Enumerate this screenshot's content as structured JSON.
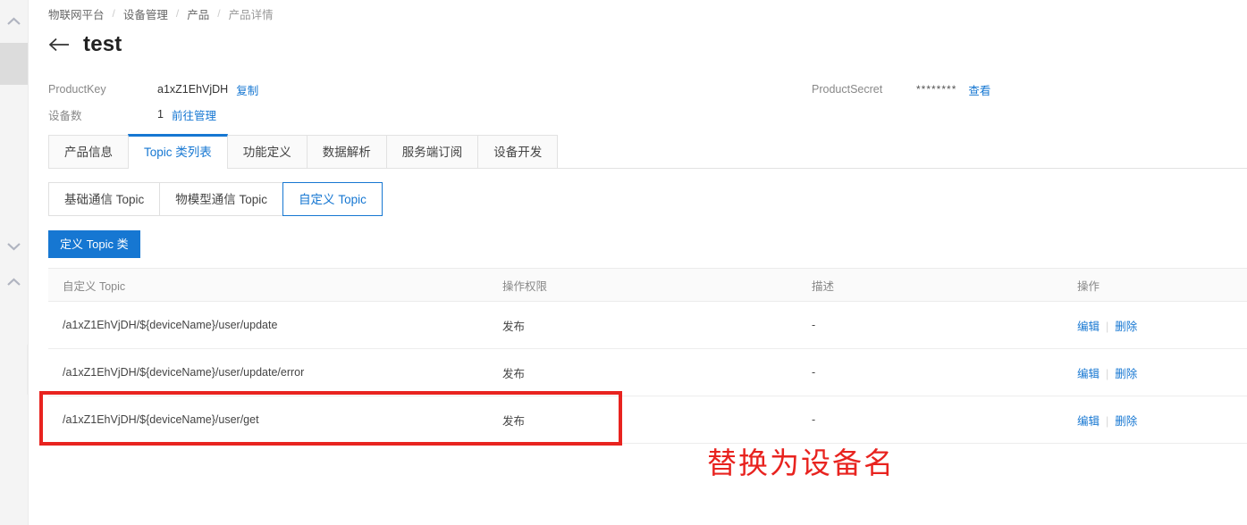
{
  "breadcrumb": {
    "items": [
      "物联网平台",
      "设备管理",
      "产品",
      "产品详情"
    ],
    "separator": "/"
  },
  "header": {
    "back_icon": "back-arrow-icon",
    "title": "test"
  },
  "info": {
    "product_key_label": "ProductKey",
    "product_key_value": "a1xZ1EhVjDH",
    "product_key_copy": "复制",
    "device_count_label": "设备数",
    "device_count_value": "1",
    "device_count_link": "前往管理",
    "product_secret_label": "ProductSecret",
    "product_secret_value": "********",
    "product_secret_view": "查看"
  },
  "tabs": [
    {
      "label": "产品信息",
      "active": false
    },
    {
      "label": "Topic 类列表",
      "active": true
    },
    {
      "label": "功能定义",
      "active": false
    },
    {
      "label": "数据解析",
      "active": false
    },
    {
      "label": "服务端订阅",
      "active": false
    },
    {
      "label": "设备开发",
      "active": false
    }
  ],
  "segmented": [
    {
      "label": "基础通信 Topic",
      "active": false
    },
    {
      "label": "物模型通信 Topic",
      "active": false
    },
    {
      "label": "自定义 Topic",
      "active": true
    }
  ],
  "primary_button": {
    "label": "定义 Topic 类"
  },
  "table": {
    "headers": [
      "自定义 Topic",
      "操作权限",
      "描述",
      "操作"
    ],
    "rows": [
      {
        "topic": "/a1xZ1EhVjDH/${deviceName}/user/update",
        "permission": "发布",
        "description": "-",
        "edit": "编辑",
        "delete": "删除"
      },
      {
        "topic": "/a1xZ1EhVjDH/${deviceName}/user/update/error",
        "permission": "发布",
        "description": "-",
        "edit": "编辑",
        "delete": "删除"
      },
      {
        "topic": "/a1xZ1EhVjDH/${deviceName}/user/get",
        "permission": "发布",
        "description": "-",
        "edit": "编辑",
        "delete": "删除"
      }
    ],
    "action_separator": "|"
  },
  "annotation": {
    "text": "替换为设备名",
    "color": "#e8231f"
  },
  "scrollbar": {
    "up_chevron": "▲",
    "down_chevron": "▼",
    "collapse_chevron": "‹"
  },
  "colors": {
    "accent": "#1677d2",
    "annotation_red": "#e8231f",
    "header_bg": "#fafafa"
  }
}
